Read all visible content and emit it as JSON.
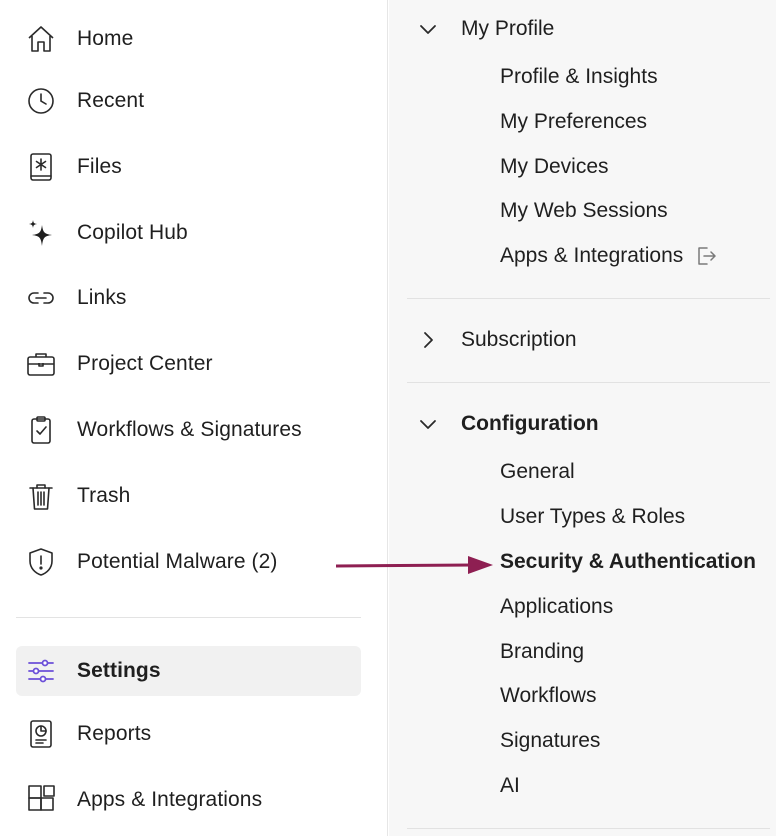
{
  "sidebar": {
    "items": [
      {
        "label": "Home",
        "icon": "home-icon"
      },
      {
        "label": "Recent",
        "icon": "clock-icon"
      },
      {
        "label": "Files",
        "icon": "files-icon"
      },
      {
        "label": "Copilot Hub",
        "icon": "sparkle-icon"
      },
      {
        "label": "Links",
        "icon": "link-icon"
      },
      {
        "label": "Project Center",
        "icon": "briefcase-icon"
      },
      {
        "label": "Workflows & Signatures",
        "icon": "clipboard-check-icon"
      },
      {
        "label": "Trash",
        "icon": "trash-icon"
      },
      {
        "label": "Potential Malware (2)",
        "icon": "shield-alert-icon"
      },
      {
        "label": "Settings",
        "icon": "sliders-icon",
        "active": true
      },
      {
        "label": "Reports",
        "icon": "report-icon"
      },
      {
        "label": "Apps & Integrations",
        "icon": "apps-grid-icon"
      }
    ]
  },
  "panel": {
    "my_profile": {
      "title": "My Profile",
      "expanded": true,
      "items": [
        "Profile & Insights",
        "My Preferences",
        "My Devices",
        "My Web Sessions",
        "Apps & Integrations"
      ]
    },
    "subscription": {
      "title": "Subscription",
      "expanded": false
    },
    "configuration": {
      "title": "Configuration",
      "expanded": true,
      "items": [
        "General",
        "User Types & Roles",
        "Security & Authentication",
        "Applications",
        "Branding",
        "Workflows",
        "Signatures",
        "AI"
      ]
    }
  },
  "colors": {
    "accent_purple": "#6b4fd8",
    "annotation_arrow": "#8e1f52",
    "panel_bg": "#f7f7f7",
    "active_bg": "#f1f1f1"
  }
}
